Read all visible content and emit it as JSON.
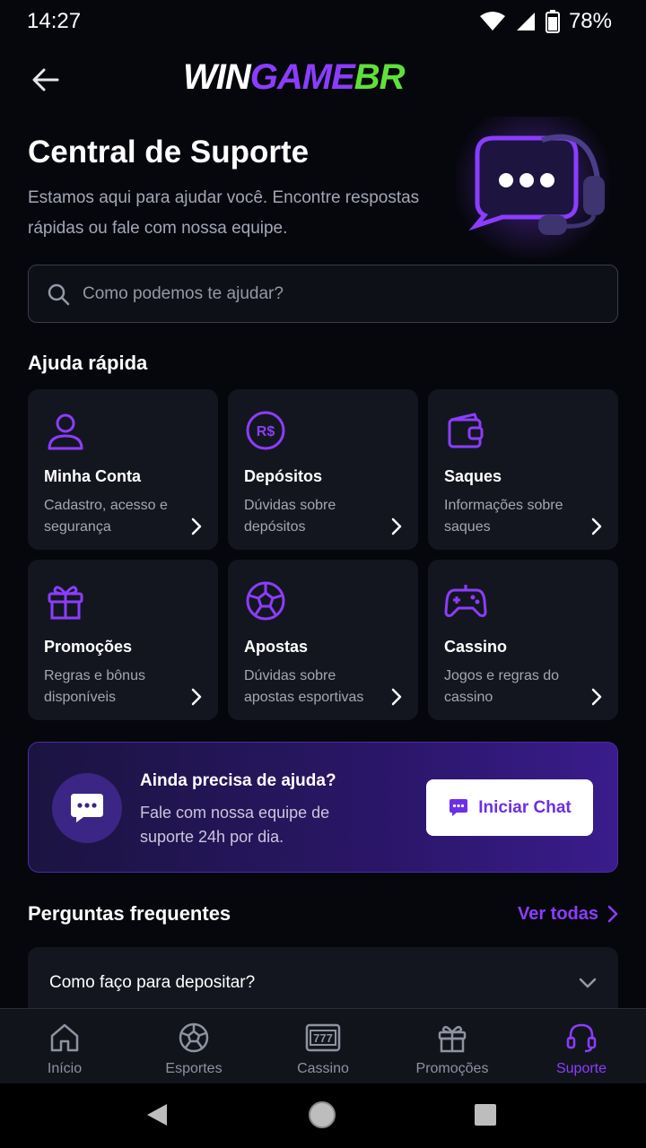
{
  "status_bar": {
    "time": "14:27",
    "battery": "78%"
  },
  "header": {
    "logo_part1": "WIN",
    "logo_part2": "GAME",
    "logo_part3": "BR"
  },
  "hero": {
    "title": "Central de Suporte",
    "subtitle": "Estamos aqui para ajudar você. Encontre respostas rápidas ou fale com nossa equipe."
  },
  "search": {
    "placeholder": "Como podemos te ajudar?",
    "value": ""
  },
  "quick_help": {
    "title": "Ajuda rápida",
    "cards": [
      {
        "title": "Minha Conta",
        "desc": "Cadastro, acesso e segurança",
        "icon": "user-icon"
      },
      {
        "title": "Depósitos",
        "desc": "Dúvidas sobre depósitos",
        "icon": "money-icon"
      },
      {
        "title": "Saques",
        "desc": "Informações sobre saques",
        "icon": "wallet-icon"
      },
      {
        "title": "Promoções",
        "desc": "Regras e bônus disponíveis",
        "icon": "gift-icon"
      },
      {
        "title": "Apostas",
        "desc": "Dúvidas sobre apostas esportivas",
        "icon": "ball-icon"
      },
      {
        "title": "Cassino",
        "desc": "Jogos e regras do cassino",
        "icon": "gamepad-icon"
      }
    ]
  },
  "help_banner": {
    "title": "Ainda precisa de ajuda?",
    "desc": "Fale com nossa equipe de suporte 24h por dia.",
    "button": "Iniciar Chat"
  },
  "faq": {
    "title": "Perguntas frequentes",
    "see_all": "Ver todas",
    "items": [
      {
        "question": "Como faço para depositar?"
      }
    ]
  },
  "bottom_nav": {
    "items": [
      {
        "label": "Início",
        "icon": "home-icon"
      },
      {
        "label": "Esportes",
        "icon": "soccer-ball-icon"
      },
      {
        "label": "Cassino",
        "icon": "slot-machine-icon"
      },
      {
        "label": "Promoções",
        "icon": "gift-icon"
      },
      {
        "label": "Suporte",
        "icon": "headset-icon",
        "active": true
      }
    ]
  },
  "colors": {
    "accent": "#8b3dff",
    "accent_green": "#5fe03a",
    "background": "#06070d",
    "card": "#14161f"
  }
}
